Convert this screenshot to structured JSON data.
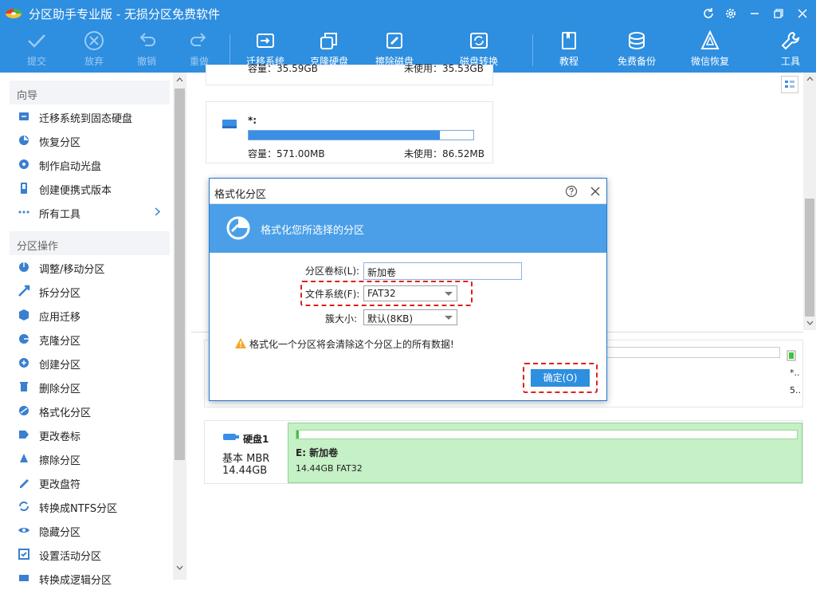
{
  "window": {
    "title": "分区助手专业版 - 无损分区免费软件"
  },
  "toolbar": {
    "commit": "提交",
    "discard": "放弃",
    "undo": "撤销",
    "redo": "重做",
    "migrate": "迁移系统",
    "clone_disk": "克隆硬盘",
    "wipe_disk": "擦除磁盘",
    "disk_convert": "磁盘转换",
    "tutorial": "教程",
    "free_backup": "免费备份",
    "wechat_recovery": "微信恢复",
    "tools": "工具"
  },
  "sidebar": {
    "wizard_title": "向导",
    "wizard_items": [
      {
        "label": "迁移系统到固态硬盘",
        "icon": "migrate-ssd-icon"
      },
      {
        "label": "恢复分区",
        "icon": "recover-partition-icon"
      },
      {
        "label": "制作启动光盘",
        "icon": "boot-disc-icon"
      },
      {
        "label": "创建便携式版本",
        "icon": "portable-icon"
      },
      {
        "label": "所有工具",
        "icon": "all-tools-icon"
      }
    ],
    "ops_title": "分区操作",
    "ops_items": [
      {
        "label": "调整/移动分区",
        "icon": "resize-icon"
      },
      {
        "label": "拆分分区",
        "icon": "split-icon"
      },
      {
        "label": "应用迁移",
        "icon": "app-migrate-icon"
      },
      {
        "label": "克隆分区",
        "icon": "clone-partition-icon"
      },
      {
        "label": "创建分区",
        "icon": "create-partition-icon"
      },
      {
        "label": "删除分区",
        "icon": "delete-partition-icon"
      },
      {
        "label": "格式化分区",
        "icon": "format-partition-icon"
      },
      {
        "label": "更改卷标",
        "icon": "change-label-icon"
      },
      {
        "label": "擦除分区",
        "icon": "wipe-partition-icon"
      },
      {
        "label": "更改盘符",
        "icon": "change-letter-icon"
      },
      {
        "label": "转换成NTFS分区",
        "icon": "convert-ntfs-icon"
      },
      {
        "label": "隐藏分区",
        "icon": "hide-partition-icon"
      },
      {
        "label": "设置活动分区",
        "icon": "set-active-icon"
      },
      {
        "label": "转换成逻辑分区",
        "icon": "convert-logical-icon"
      }
    ]
  },
  "partitions": {
    "top_card": {
      "capacity": "容量：35.59GB",
      "unused": "未使用：35.53GB"
    },
    "card_star": {
      "name": "*:",
      "capacity": "容量：571.00MB",
      "unused": "未使用：86.52MB",
      "used_fraction": 0.85
    }
  },
  "disk1": {
    "name": "硬盘1",
    "type": "基本 MBR",
    "size": "14.44GB",
    "partition": {
      "name": "E: 新加卷",
      "info": "14.44GB FAT32"
    }
  },
  "disk_row_right": {
    "name": "*..",
    "size": "5.."
  },
  "dialog": {
    "title": "格式化分区",
    "banner_text": "格式化您所选择的分区",
    "label_volume": "分区卷标(L):",
    "volume_value": "新加卷",
    "label_fs": "文件系统(F):",
    "fs_value": "FAT32",
    "label_cluster": "簇大小:",
    "cluster_value": "默认(8KB)",
    "warning": "格式化一个分区将会清除这个分区上的所有数据!",
    "ok_button": "确定(O)"
  },
  "colors": {
    "accent": "#2e8ee0",
    "banner": "#4a9fe8",
    "highlight_dash": "#e02020",
    "partition_green": "#c6f0c6"
  }
}
